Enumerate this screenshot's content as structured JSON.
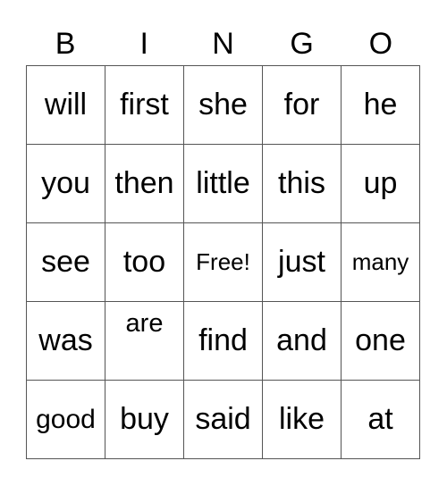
{
  "header": [
    "B",
    "I",
    "N",
    "G",
    "O"
  ],
  "rows": [
    [
      "will",
      "first",
      "she",
      "for",
      "he"
    ],
    [
      "you",
      "then",
      "little",
      "this",
      "up"
    ],
    [
      "see",
      "too",
      "Free!",
      "just",
      "many"
    ],
    [
      "was",
      "are",
      "find",
      "and",
      "one"
    ],
    [
      "good",
      "buy",
      "said",
      "like",
      "at"
    ]
  ]
}
